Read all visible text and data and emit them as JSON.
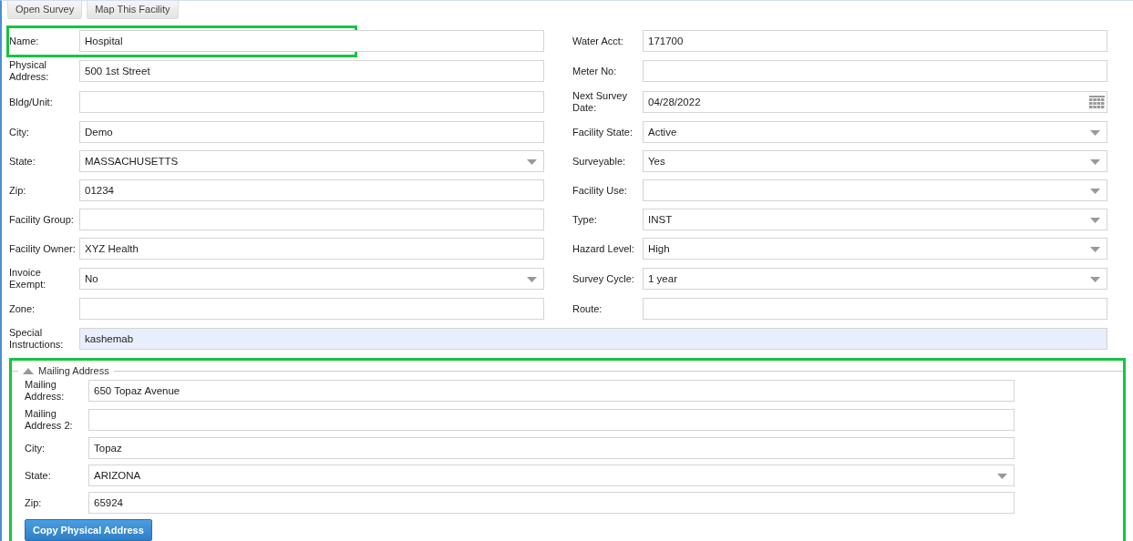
{
  "toolbar": {
    "buttons": [
      "Open Survey",
      "Map This Facility"
    ]
  },
  "rows": [
    {
      "left": {
        "label": "Name:",
        "kind": "text",
        "value": "Hospital",
        "highlighted": true
      },
      "right": {
        "label": "Water Acct:",
        "kind": "text",
        "value": "171700"
      }
    },
    {
      "left": {
        "label": "Physical Address:",
        "kind": "text",
        "value": "500 1st Street"
      },
      "right": {
        "label": "Meter No:",
        "kind": "text"
      }
    },
    {
      "left": {
        "label": "Bldg/Unit:",
        "kind": "text"
      },
      "right": {
        "label": "Next Survey Date:",
        "kind": "date",
        "value": "04/28/2022"
      }
    },
    {
      "left": {
        "label": "City:",
        "kind": "text",
        "value": "Demo"
      },
      "right": {
        "label": "Facility State:",
        "kind": "select",
        "value": "Active"
      }
    },
    {
      "left": {
        "label": "State:",
        "kind": "select",
        "value": "MASSACHUSETTS"
      },
      "right": {
        "label": "Surveyable:",
        "kind": "select",
        "value": "Yes"
      }
    },
    {
      "left": {
        "label": "Zip:",
        "kind": "text",
        "value": "01234"
      },
      "right": {
        "label": "Facility Use:",
        "kind": "select"
      }
    },
    {
      "left": {
        "label": "Facility Group:",
        "kind": "text"
      },
      "right": {
        "label": "Type:",
        "kind": "select",
        "value": "INST"
      }
    },
    {
      "left": {
        "label": "Facility Owner:",
        "kind": "text",
        "value": "XYZ Health"
      },
      "right": {
        "label": "Hazard Level:",
        "kind": "select",
        "value": "High"
      }
    },
    {
      "left": {
        "label": "Invoice Exempt:",
        "kind": "select",
        "value": "No"
      },
      "right": {
        "label": "Survey Cycle:",
        "kind": "select",
        "value": "1 year"
      }
    },
    {
      "left": {
        "label": "Zone:",
        "kind": "text"
      },
      "right": {
        "label": "Route:",
        "kind": "text"
      }
    }
  ],
  "special_instructions": {
    "label": "Special Instructions:",
    "value": "kashemab"
  },
  "mailing": {
    "title": "Mailing Address",
    "expanded": true,
    "highlighted": true,
    "fields": [
      {
        "label": "Mailing Address:",
        "kind": "text",
        "value": "650 Topaz Avenue"
      },
      {
        "label": "Mailing Address 2:",
        "kind": "text"
      },
      {
        "label": "City:",
        "kind": "text",
        "value": "Topaz"
      },
      {
        "label": "State:",
        "kind": "select",
        "value": "ARIZONA"
      },
      {
        "label": "Zip:",
        "kind": "text",
        "value": "65924"
      }
    ],
    "button": "Copy Physical Address"
  }
}
